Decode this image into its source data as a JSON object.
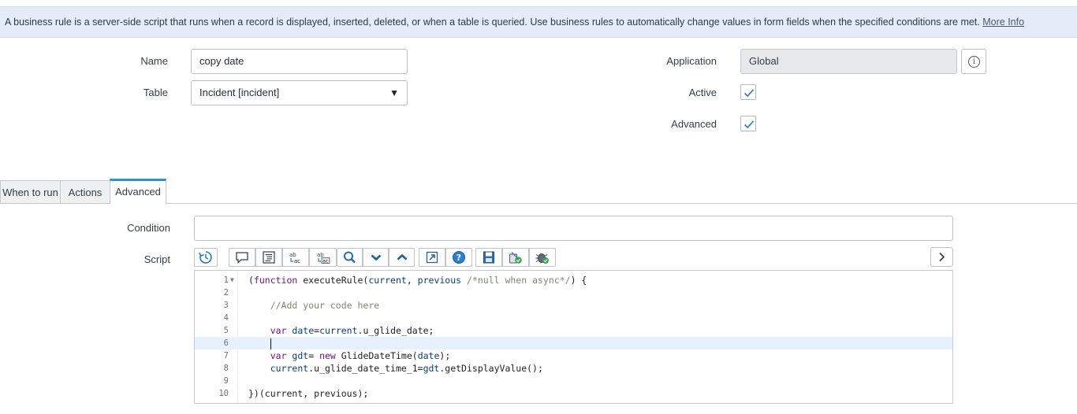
{
  "banner": {
    "text": "A business rule is a server-side script that runs when a record is displayed, inserted, deleted, or when a table is queried. Use business rules to automatically change values in form fields when the specified conditions are met.",
    "link": "More Info"
  },
  "form": {
    "name_label": "Name",
    "name_value": "copy date",
    "table_label": "Table",
    "table_value": "Incident [incident]",
    "application_label": "Application",
    "application_value": "Global",
    "active_label": "Active",
    "active_checked": true,
    "advanced_label": "Advanced",
    "advanced_checked": true
  },
  "tabs": [
    {
      "label": "When to run",
      "active": false
    },
    {
      "label": "Actions",
      "active": false
    },
    {
      "label": "Advanced",
      "active": true
    }
  ],
  "advanced": {
    "condition_label": "Condition",
    "condition_value": "",
    "script_label": "Script"
  },
  "toolbar": {
    "icons": [
      "history-icon",
      "comment-icon",
      "format-code-icon",
      "replace-icon",
      "replace-all-icon",
      "search-icon",
      "next-match-icon",
      "previous-match-icon",
      "fullscreen-icon",
      "help-icon",
      "save-icon",
      "syntax-check-icon",
      "debug-icon",
      "expand-right-icon"
    ]
  },
  "script": {
    "lines": [
      {
        "num": "1",
        "folded": true,
        "html": "<span class=\"fn\">(</span><span class=\"kw\">function</span> executeRule(<span class=\"var\">current</span>, <span class=\"var\">previous</span> <span class=\"cm\">/*null when async*/</span>) {"
      },
      {
        "num": "2",
        "html": ""
      },
      {
        "num": "3",
        "html": "    <span class=\"cm\">//Add your code here</span>"
      },
      {
        "num": "4",
        "html": ""
      },
      {
        "num": "5",
        "html": "    <span class=\"kw\">var</span> <span class=\"var\">date</span>=<span class=\"var\">current</span>.u_glide_date;"
      },
      {
        "num": "6",
        "current": true,
        "html": "    <span class=\"cursor\"></span>"
      },
      {
        "num": "7",
        "html": "    <span class=\"kw\">var</span> <span class=\"var\">gdt</span>= <span class=\"kw\">new</span> GlideDateTime(<span class=\"var\">date</span>);"
      },
      {
        "num": "8",
        "html": "    <span class=\"var\">current</span>.u_glide_date_time_1=<span class=\"var\">gdt</span>.getDisplayValue();"
      },
      {
        "num": "9",
        "html": ""
      },
      {
        "num": "10",
        "html": "})(current, previous);"
      }
    ]
  }
}
